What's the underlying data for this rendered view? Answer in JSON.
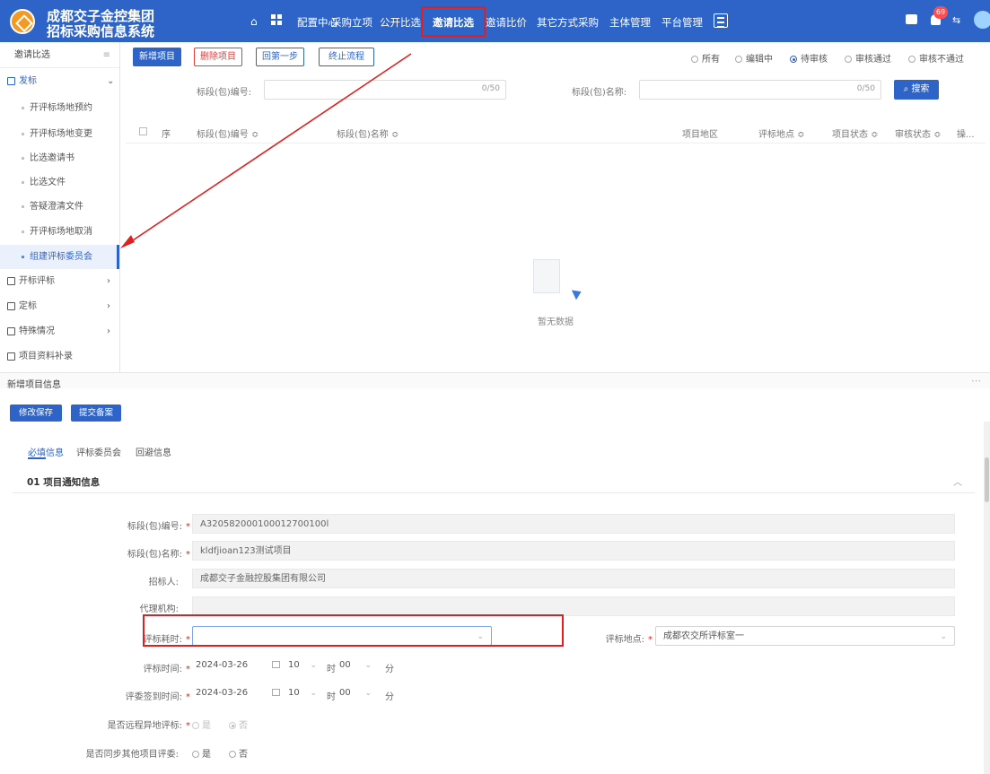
{
  "header": {
    "title_line1": "成都交子金控集团",
    "title_line2": "招标采购信息系统",
    "badge": "69",
    "lang_icon": "translate-icon",
    "nav": [
      "配置中心",
      "采购立项",
      "公开比选",
      "邀请比选",
      "邀请比价",
      "其它方式采购",
      "主体管理",
      "平台管理"
    ],
    "active_nav": "邀请比选"
  },
  "sidebar": {
    "title": "邀请比选",
    "group1": "发标",
    "items": [
      "开评标场地预约",
      "开评标场地变更",
      "比选邀请书",
      "比选文件",
      "答疑澄清文件",
      "开评标场地取消",
      "组建评标委员会"
    ],
    "active": "组建评标委员会",
    "groups": [
      "开标评标",
      "定标",
      "特殊情况",
      "项目资料补录"
    ]
  },
  "toolbar": {
    "add": "新增项目",
    "delete": "删除项目",
    "back": "回第一步",
    "stop": "终止流程"
  },
  "filters": [
    "所有",
    "编辑中",
    "待审核",
    "审核通过",
    "审核不通过"
  ],
  "filter_selected": "待审核",
  "search": {
    "code_label": "标段(包)编号:",
    "code_count": "0/50",
    "name_label": "标段(包)名称:",
    "name_count": "0/50",
    "button": "搜索"
  },
  "table": {
    "headers": [
      "序",
      "标段(包)编号 ≎",
      "标段(包)名称 ≎",
      "项目地区",
      "评标地点 ≎",
      "项目状态 ≎",
      "审核状态 ≎",
      "操..."
    ],
    "empty": "暂无数据"
  },
  "form": {
    "title": "新增项目信息",
    "save": "修改保存",
    "submit": "提交备案",
    "tabs": [
      "必填信息",
      "评标委员会",
      "回避信息"
    ],
    "section": "01  项目通知信息",
    "code_label": "标段(包)编号:",
    "code_value": "A320582000100012700100l",
    "name_label": "标段(包)名称:",
    "name_value": "kldfjioan123测试项目",
    "tenderer_label": "招标人:",
    "tenderer_value": "成都交子金融控股集团有限公司",
    "agency_label": "代理机构:",
    "agency_value": "",
    "duration_label": "评标耗时:",
    "duration_value": "",
    "place_label": "评标地点:",
    "place_value": "成都农交所评标室一",
    "eval_time_label": "评标时间:",
    "eval_date": "2024-03-26",
    "eval_hour": "10",
    "eval_min": "00",
    "signin_label": "评委签到时间:",
    "signin_date": "2024-03-26",
    "signin_hour": "10",
    "signin_min": "00",
    "hour_unit": "时",
    "min_unit": "分",
    "remote_label": "是否远程异地评标:",
    "remote_yes": "是",
    "remote_no": "否",
    "remote_selected": "否",
    "sync_label": "是否同步其他项目评委:",
    "sync_yes": "是",
    "sync_no": "否"
  },
  "colors": {
    "header": "#2e63c8",
    "danger": "#e23c3c",
    "highlight": "#e02020"
  }
}
